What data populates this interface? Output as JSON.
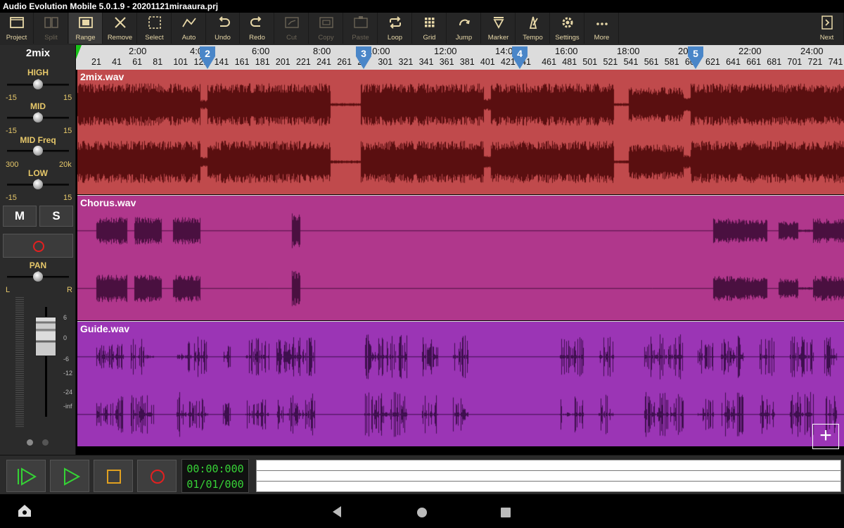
{
  "window": {
    "title": "Audio Evolution Mobile 5.0.1.9 - 20201121miraaura.prj"
  },
  "toolbar": {
    "items": [
      {
        "label": "Project",
        "icon": "folder-icon",
        "enabled": true
      },
      {
        "label": "Split",
        "icon": "split-icon",
        "enabled": false
      },
      {
        "label": "Range",
        "icon": "range-icon",
        "enabled": true
      },
      {
        "label": "Remove",
        "icon": "remove-x-icon",
        "enabled": true
      },
      {
        "label": "Select",
        "icon": "select-icon",
        "enabled": true
      },
      {
        "label": "Auto",
        "icon": "automation-icon",
        "enabled": true
      },
      {
        "label": "Undo",
        "icon": "undo-icon",
        "enabled": true
      },
      {
        "label": "Redo",
        "icon": "redo-icon",
        "enabled": true
      },
      {
        "label": "Cut",
        "icon": "cut-icon",
        "enabled": false
      },
      {
        "label": "Copy",
        "icon": "copy-icon",
        "enabled": false
      },
      {
        "label": "Paste",
        "icon": "paste-icon",
        "enabled": false
      },
      {
        "label": "Loop",
        "icon": "loop-icon",
        "enabled": true
      },
      {
        "label": "Grid",
        "icon": "grid-icon",
        "enabled": true
      },
      {
        "label": "Jump",
        "icon": "jump-icon",
        "enabled": true
      },
      {
        "label": "Marker",
        "icon": "marker-icon",
        "enabled": true
      },
      {
        "label": "Tempo",
        "icon": "metronome-icon",
        "enabled": true
      },
      {
        "label": "Settings",
        "icon": "gear-icon",
        "enabled": true
      },
      {
        "label": "More",
        "icon": "more-dots-icon",
        "enabled": true
      }
    ],
    "next_label": "Next"
  },
  "strip": {
    "track_name": "2mix",
    "high": {
      "label": "HIGH",
      "min": "-15",
      "max": "15",
      "value": 0.5
    },
    "mid": {
      "label": "MID",
      "min": "-15",
      "max": "15",
      "value": 0.5
    },
    "mid_freq": {
      "label": "MID Freq",
      "min": "300",
      "max": "20k",
      "value": 0.5
    },
    "low": {
      "label": "LOW",
      "min": "-15",
      "max": "15",
      "value": 0.5
    },
    "mute_label": "M",
    "solo_label": "S",
    "pan": {
      "label": "PAN",
      "left": "L",
      "right": "R",
      "value": 0.5
    },
    "fader_scale": [
      "6",
      "0",
      "-6",
      "-12",
      "-24",
      "-inf"
    ]
  },
  "ruler": {
    "times": [
      "2:00",
      "4:0",
      "6:00",
      "8:00",
      "10:00",
      "12:00",
      "14:0",
      "16:00",
      "18:00",
      "20:",
      "22:00",
      "24:00"
    ],
    "bars": [
      "21",
      "41",
      "61",
      "81",
      "101",
      "121",
      "141",
      "161",
      "181",
      "201",
      "221",
      "241",
      "261",
      "2",
      "301",
      "321",
      "341",
      "361",
      "381",
      "401",
      "421",
      "41",
      "461",
      "481",
      "501",
      "521",
      "541",
      "561",
      "581",
      "60",
      "621",
      "641",
      "661",
      "681",
      "701",
      "721",
      "741"
    ],
    "markers": [
      "2",
      "3",
      "4",
      "5"
    ]
  },
  "tracks": [
    {
      "name": "2mix.wav",
      "bg": "#c04a4c",
      "wave": "#5a0f10"
    },
    {
      "name": "Chorus.wav",
      "bg": "#b0378c",
      "wave": "#4a1040"
    },
    {
      "name": "Guide.wav",
      "bg": "#9b35b5",
      "wave": "#3e0f4e"
    }
  ],
  "transport": {
    "time": "00:00:000",
    "position": "01/01/000"
  },
  "colors": {
    "accent": "#e7c86a",
    "counter": "#37d337",
    "record": "#e32020"
  }
}
